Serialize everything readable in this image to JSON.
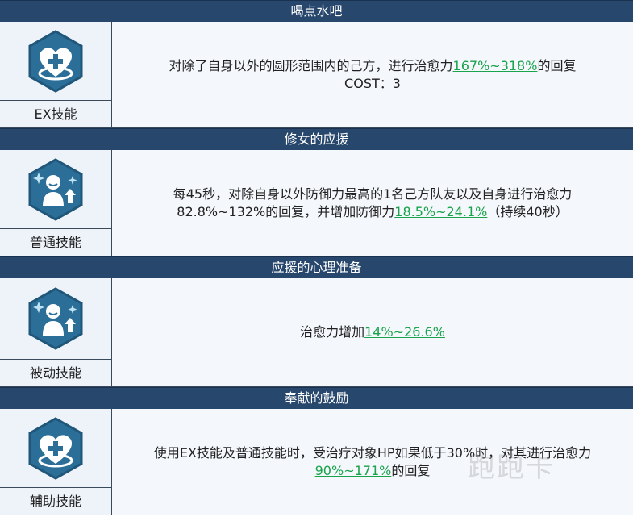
{
  "skills": [
    {
      "title": "喝点水吧",
      "label": "EX技能",
      "icon": "heart-plus-icon",
      "line1_pre": "对除了自身以外的圆形范围内的己方，进行治愈力",
      "line1_hl": "167%~318%",
      "line1_post": "的回复",
      "line2": "COST：3"
    },
    {
      "title": "修女的应援",
      "label": "普通技能",
      "icon": "person-buff-icon",
      "line1": "每45秒，对除自身以外防御力最高的1名己方队友以及自身进行治愈力",
      "line2_pre": "82.8%~132%的回复，并增加防御力",
      "line2_hl": "18.5%~24.1%",
      "line2_post": "（持续40秒）"
    },
    {
      "title": "应援的心理准备",
      "label": "被动技能",
      "icon": "person-buff-icon",
      "line1_pre": "治愈力增加",
      "line1_hl": "14%~26.6%"
    },
    {
      "title": "奉献的鼓励",
      "label": "辅助技能",
      "icon": "heart-plus-icon",
      "line1": "使用EX技能及普通技能时，受治疗对象HP如果低于30%时，对其进行治愈力",
      "line2_hl": "90%~171%",
      "line2_post": "的回复"
    }
  ],
  "watermark": "跑跑卡"
}
